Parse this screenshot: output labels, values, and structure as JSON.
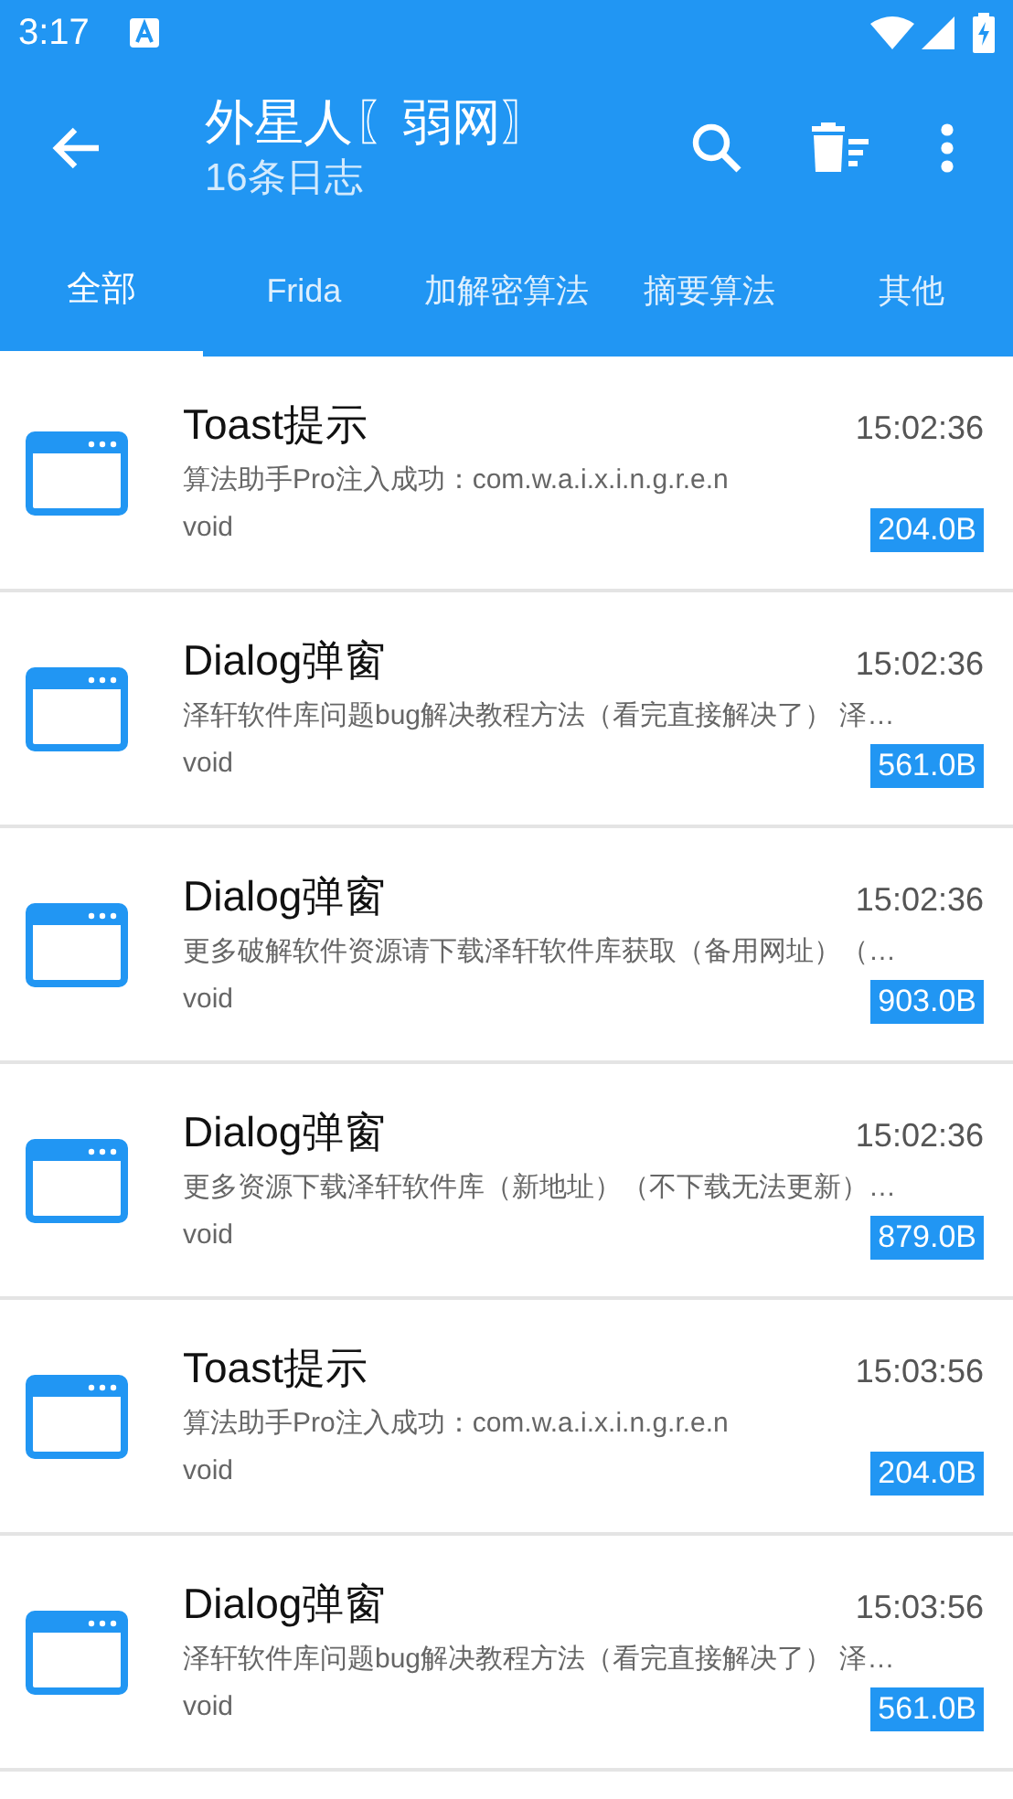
{
  "status_bar": {
    "time": "3:17"
  },
  "toolbar": {
    "title": "外星人〖弱网〗",
    "subtitle": "16条日志"
  },
  "tabs": [
    {
      "label": "全部",
      "selected": true
    },
    {
      "label": "Frida",
      "selected": false
    },
    {
      "label": "加解密算法",
      "selected": false
    },
    {
      "label": "摘要算法",
      "selected": false
    },
    {
      "label": "其他",
      "selected": false
    }
  ],
  "logs": [
    {
      "title": "Toast提示",
      "time": "15:02:36",
      "message": "算法助手Pro注入成功：com.w.a.i.x.i.n.g.r.e.n",
      "type": "void",
      "size": "204.0B"
    },
    {
      "title": "Dialog弹窗",
      "time": "15:02:36",
      "message": "泽轩软件库问题bug解决教程方法（看完直接解决了） 泽…",
      "type": "void",
      "size": "561.0B"
    },
    {
      "title": "Dialog弹窗",
      "time": "15:02:36",
      "message": "更多破解软件资源请下载泽轩软件库获取（备用网址）（…",
      "type": "void",
      "size": "903.0B"
    },
    {
      "title": "Dialog弹窗",
      "time": "15:02:36",
      "message": "更多资源下载泽轩软件库（新地址）（不下载无法更新）…",
      "type": "void",
      "size": "879.0B"
    },
    {
      "title": "Toast提示",
      "time": "15:03:56",
      "message": "算法助手Pro注入成功：com.w.a.i.x.i.n.g.r.e.n",
      "type": "void",
      "size": "204.0B"
    },
    {
      "title": "Dialog弹窗",
      "time": "15:03:56",
      "message": "泽轩软件库问题bug解决教程方法（看完直接解决了） 泽…",
      "type": "void",
      "size": "561.0B"
    }
  ]
}
